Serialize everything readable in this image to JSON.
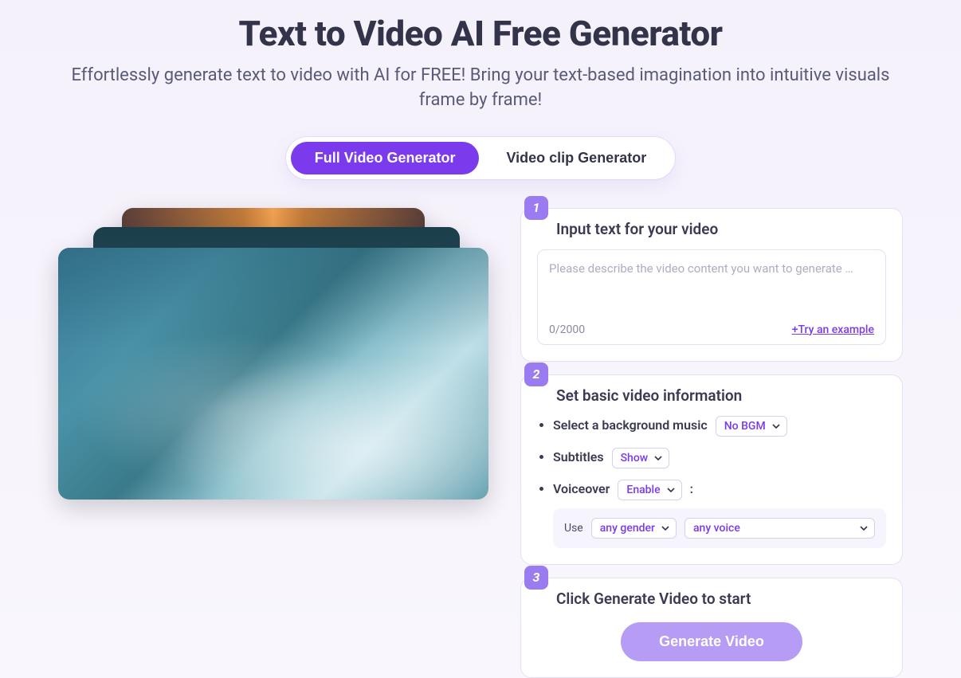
{
  "hero": {
    "title": "Text to Video AI Free Generator",
    "subtitle": "Effortlessly generate text to video with AI for FREE! Bring your text-based imagination into intuitive visuals frame by frame!"
  },
  "tabs": {
    "full": "Full Video Generator",
    "clip": "Video clip Generator"
  },
  "step1": {
    "badge": "1",
    "title": "Input text for your video",
    "placeholder": "Please describe the video content you want to generate …",
    "counter": "0/2000",
    "try_link": "+Try an example"
  },
  "step2": {
    "badge": "2",
    "title": "Set basic video information",
    "bgm_label": "Select a background music",
    "bgm_value": "No BGM",
    "subtitles_label": "Subtitles",
    "subtitles_value": "Show",
    "voiceover_label": "Voiceover",
    "voiceover_value": "Enable",
    "voiceover_colon": ":",
    "use_label": "Use",
    "gender_value": "any gender",
    "voice_value": "any voice"
  },
  "step3": {
    "badge": "3",
    "title": "Click Generate Video to start",
    "button": "Generate Video"
  }
}
